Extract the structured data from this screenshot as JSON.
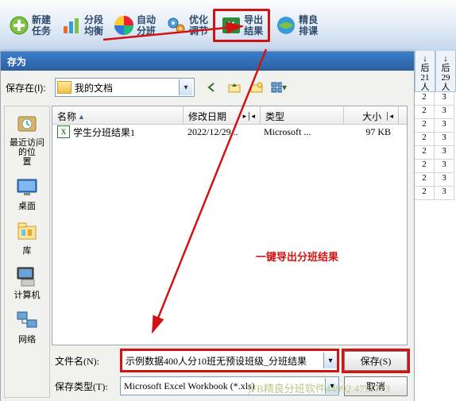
{
  "toolbar": {
    "items": [
      {
        "label": "新建\n任务"
      },
      {
        "label": "分段\n均衡"
      },
      {
        "label": "自动\n分班"
      },
      {
        "label": "优化\n调节"
      },
      {
        "label": "导出\n结果"
      },
      {
        "label": "精良\n排课"
      }
    ]
  },
  "dialog": {
    "title": "存为",
    "lookin_label": "保存在(I):",
    "lookin_value": "我的文档",
    "columns": {
      "name": "名称",
      "date": "修改日期",
      "type": "类型",
      "size": "大小"
    },
    "files": [
      {
        "name": "学生分班结果1",
        "date": "2022/12/29...",
        "type": "Microsoft ...",
        "size": "97 KB"
      }
    ],
    "places": [
      {
        "label": "最近访问的位\n置"
      },
      {
        "label": "桌面"
      },
      {
        "label": "库"
      },
      {
        "label": "计算机"
      },
      {
        "label": "网络"
      }
    ],
    "filename_label": "文件名(N):",
    "filename_value": "示例数据400人分10班无预设班级_分班结果",
    "type_label": "保存类型(T):",
    "type_value": "Microsoft Excel Workbook (*.xls)",
    "save_btn": "保存(S)",
    "cancel_btn": "取消"
  },
  "annotation": "一键导出分班结果",
  "watermark": "jFB精良分班软件44992.4751773",
  "sheet": {
    "headers": [
      {
        "l1": "↓",
        "l2": "后",
        "l3": "21",
        "l4": "人"
      },
      {
        "l1": "↓",
        "l2": "后",
        "l3": "29",
        "l4": "人"
      }
    ],
    "rows": [
      [
        "2",
        "3"
      ],
      [
        "2",
        "3"
      ],
      [
        "2",
        "3"
      ],
      [
        "2",
        "3"
      ],
      [
        "2",
        "3"
      ],
      [
        "2",
        "3"
      ],
      [
        "2",
        "3"
      ],
      [
        "2",
        "3"
      ]
    ]
  }
}
